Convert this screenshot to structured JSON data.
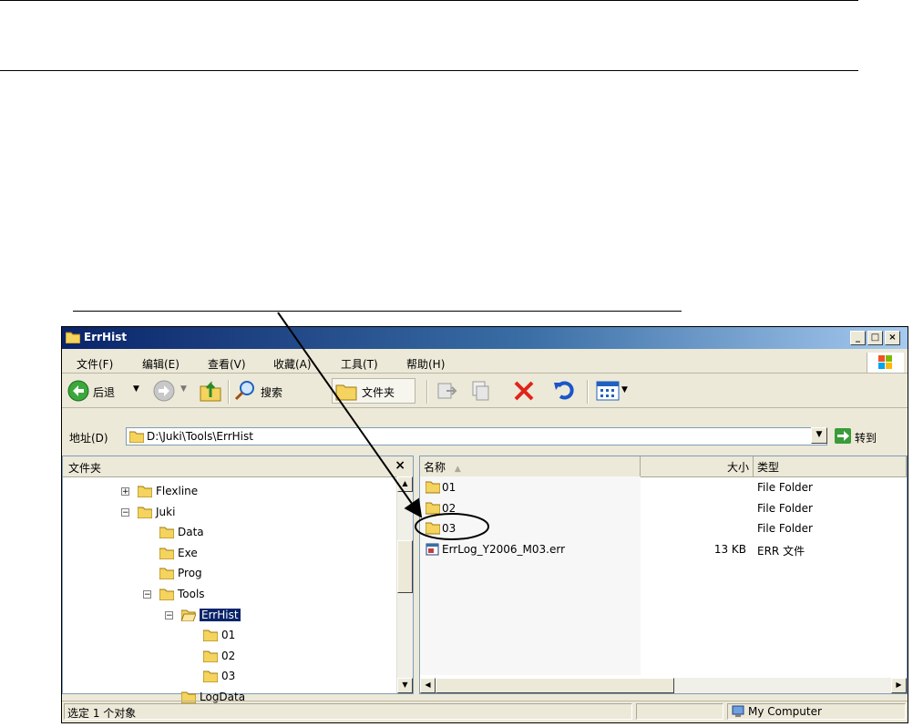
{
  "window": {
    "title": "ErrHist"
  },
  "menu": [
    "文件(F)",
    "编辑(E)",
    "查看(V)",
    "收藏(A)",
    "工具(T)",
    "帮助(H)"
  ],
  "toolbar": {
    "back": "后退",
    "search": "搜索",
    "folders": "文件夹"
  },
  "address": {
    "label": "地址(D)",
    "value": "D:\\Juki\\Tools\\ErrHist",
    "go": "转到"
  },
  "folder_pane": {
    "title": "文件夹",
    "close": "×",
    "tree": [
      {
        "label": "Flexline",
        "depth": 0,
        "expander": "+",
        "selected": false
      },
      {
        "label": "Juki",
        "depth": 0,
        "expander": "−",
        "selected": false
      },
      {
        "label": "Data",
        "depth": 1,
        "expander": "",
        "selected": false
      },
      {
        "label": "Exe",
        "depth": 1,
        "expander": "",
        "selected": false
      },
      {
        "label": "Prog",
        "depth": 1,
        "expander": "",
        "selected": false
      },
      {
        "label": "Tools",
        "depth": 1,
        "expander": "−",
        "selected": false
      },
      {
        "label": "ErrHist",
        "depth": 2,
        "expander": "−",
        "selected": true
      },
      {
        "label": "01",
        "depth": 3,
        "expander": "",
        "selected": false
      },
      {
        "label": "02",
        "depth": 3,
        "expander": "",
        "selected": false
      },
      {
        "label": "03",
        "depth": 3,
        "expander": "",
        "selected": false
      },
      {
        "label": "LogData",
        "depth": 2,
        "expander": "",
        "selected": false
      }
    ]
  },
  "file_list": {
    "columns": {
      "name": "名称",
      "size": "大小",
      "type": "类型"
    },
    "rows": [
      {
        "name": "01",
        "size": "",
        "type": "File Folder",
        "kind": "folder"
      },
      {
        "name": "02",
        "size": "",
        "type": "File Folder",
        "kind": "folder"
      },
      {
        "name": "03",
        "size": "",
        "type": "File Folder",
        "kind": "folder"
      },
      {
        "name": "ErrLog_Y2006_M03.err",
        "size": "13 KB",
        "type": "ERR 文件",
        "kind": "file"
      }
    ]
  },
  "status": {
    "left": "选定 1 个对象",
    "right": "My Computer"
  },
  "colors": {
    "selection": "#0a246a",
    "folder": "#f4d35e",
    "annotation": "#000000"
  }
}
